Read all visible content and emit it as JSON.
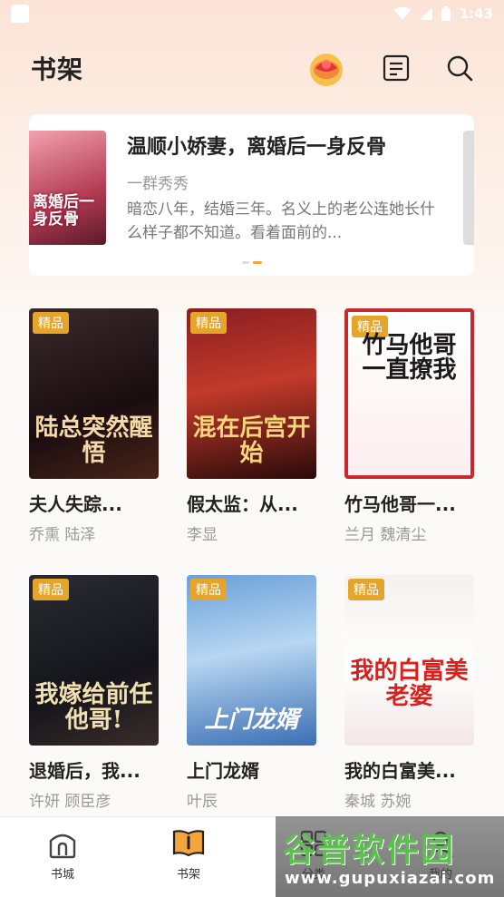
{
  "status_bar": {
    "time": "1:43"
  },
  "header": {
    "title": "书架"
  },
  "featured": {
    "title": "温顺小娇妻，离婚后一身反骨",
    "author": "一群秀秀",
    "description": "暗恋八年，结婚三年。名义上的老公连她长什么样子都不知道。看着面前的...",
    "cover_text": "离婚后一身反骨"
  },
  "badge_label": "精品",
  "books": [
    {
      "title": "夫人失踪...",
      "authors": "乔熏  陆泽",
      "cover_text": "陆总突然醒悟",
      "cover_bg": "linear-gradient(160deg,#3a2a2a,#1a0d10 60%,#4a2418)",
      "cover_fg": "#f6d9a8"
    },
    {
      "title": "假太监：从...",
      "authors": "李显",
      "cover_text": "混在后宫开始",
      "cover_bg": "linear-gradient(170deg,#8a1e22,#c23a2a 45%,#2a0a0a)",
      "cover_fg": "#f7d57a"
    },
    {
      "title": "竹马他哥一...",
      "authors": "兰月  魏清尘",
      "cover_text": "竹马他哥一直撩我",
      "cover_bg": "linear-gradient(180deg,#ffffff,#fdeef0)",
      "cover_fg": "#1a1a1a"
    },
    {
      "title": "退婚后，我...",
      "authors": "许妍  顾臣彦",
      "cover_text": "我嫁给前任他哥!",
      "cover_bg": "linear-gradient(160deg,#2b2b33,#14141a 60%,#3a2d2a)",
      "cover_fg": "#f2e1b0"
    },
    {
      "title": "上门龙婿",
      "authors": "叶辰",
      "cover_text": "上门龙婿",
      "cover_bg": "linear-gradient(170deg,#6aa0d8,#b7d6f2 45%,#3b6fb4)",
      "cover_fg": "#ffffff"
    },
    {
      "title": "我的白富美...",
      "authors": "秦城  苏婉",
      "cover_text": "我的白富美老婆",
      "cover_bg": "linear-gradient(180deg,#f5f1ef,#ffffff 55%,#f3e6e6)",
      "cover_fg": "#d9201c"
    }
  ],
  "bottom_nav": [
    {
      "label": "书城"
    },
    {
      "label": "书架"
    },
    {
      "label": "分类"
    },
    {
      "label": "我的"
    }
  ],
  "watermark": {
    "text": "谷普软件园",
    "url": "www.gupuxiazai.com"
  },
  "colors": {
    "accent": "#f3a43a",
    "badge": "#e5a52b"
  }
}
